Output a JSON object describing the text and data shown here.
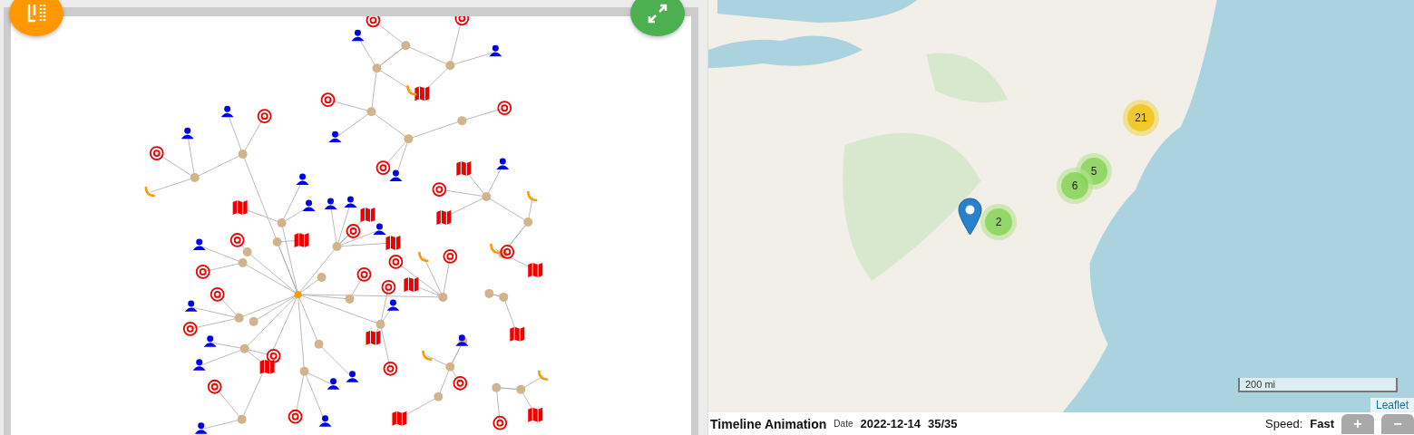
{
  "map": {
    "clusters": [
      {
        "count": "21",
        "kind": "medium"
      },
      {
        "count": "5",
        "kind": "small"
      },
      {
        "count": "6",
        "kind": "small"
      },
      {
        "count": "2",
        "kind": "small"
      }
    ],
    "scale": "200 mi",
    "attribution": "Leaflet"
  },
  "timeline": {
    "title": "Timeline Animation",
    "date_label": "Date",
    "date": "2022-12-14",
    "progress": "35/35",
    "speed_label": "Speed:",
    "speed": "Fast",
    "zoom_buttons": [
      "+",
      "−"
    ]
  }
}
